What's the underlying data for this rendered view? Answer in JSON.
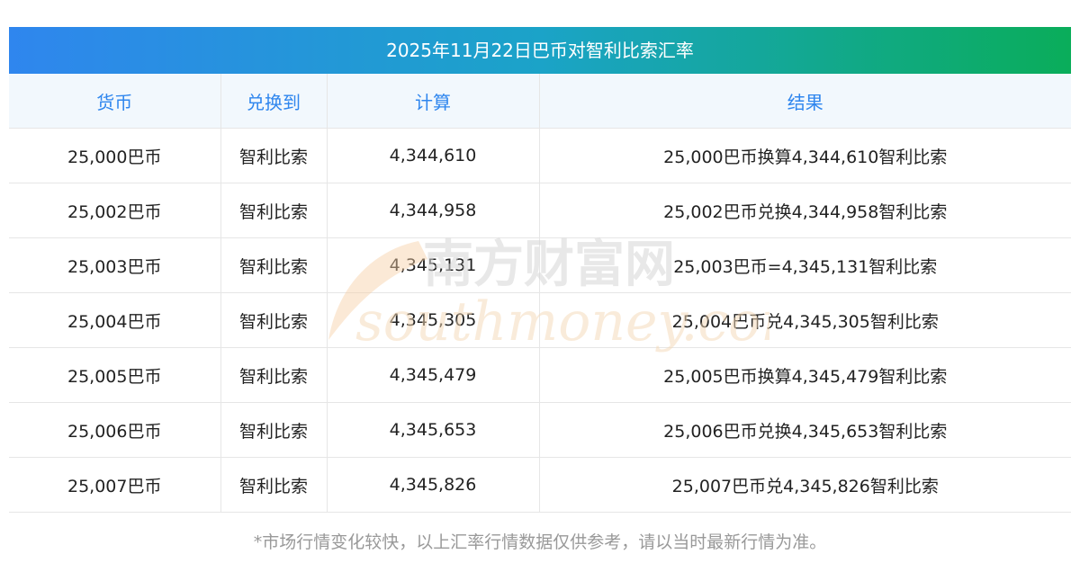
{
  "title": "2025年11月22日巴币对智利比索汇率",
  "headers": [
    "货币",
    "兑换到",
    "计算",
    "结果"
  ],
  "rows": [
    [
      "25,000巴币",
      "智利比索",
      "4,344,610",
      "25,000巴币换算4,344,610智利比索"
    ],
    [
      "25,002巴币",
      "智利比索",
      "4,344,958",
      "25,002巴币兑换4,344,958智利比索"
    ],
    [
      "25,003巴币",
      "智利比索",
      "4,345,131",
      "25,003巴币=4,345,131智利比索"
    ],
    [
      "25,004巴币",
      "智利比索",
      "4,345,305",
      "25,004巴币兑4,345,305智利比索"
    ],
    [
      "25,005巴币",
      "智利比索",
      "4,345,479",
      "25,005巴币换算4,345,479智利比索"
    ],
    [
      "25,006巴币",
      "智利比索",
      "4,345,653",
      "25,006巴币兑换4,345,653智利比索"
    ],
    [
      "25,007巴币",
      "智利比索",
      "4,345,826",
      "25,007巴币兑4,345,826智利比索"
    ]
  ],
  "footnote": "*市场行情变化较快，以上汇率行情数据仅供参考，请以当时最新行情为准。",
  "watermark": {
    "cn_text": "南方财富网",
    "en_text": "southmoney.com"
  },
  "colors": {
    "title_gradient_start": "#2f86ee",
    "title_gradient_end": "#0aad5a",
    "header_text": "#2f86ee",
    "header_bg": "#f2f8fd",
    "footnote_text": "#999999"
  }
}
